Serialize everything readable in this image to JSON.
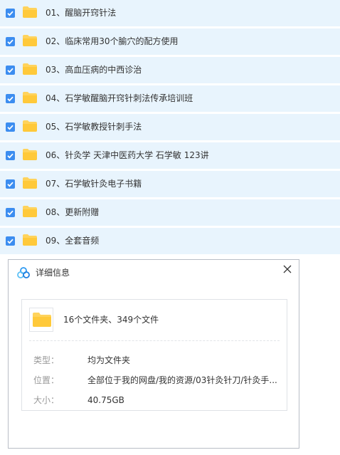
{
  "files": [
    {
      "name": "01、醒脑开窍针法"
    },
    {
      "name": "02、临床常用30个腧穴的配方使用"
    },
    {
      "name": "03、高血压病的中西诊治"
    },
    {
      "name": "04、石学敏醒脑开窍针刺法传承培训班"
    },
    {
      "name": "05、石学敏教授针刺手法"
    },
    {
      "name": "06、针灸学 天津中医药大学 石学敏 123讲"
    },
    {
      "name": "07、石学敏针灸电子书籍"
    },
    {
      "name": "08、更新附赠"
    },
    {
      "name": "09、全套音频"
    }
  ],
  "dialog": {
    "title": "详细信息",
    "summary": "16个文件夹、349个文件",
    "type_label": "类型：",
    "type_value": "均为文件夹",
    "location_label": "位置：",
    "location_value": "全部位于我的网盘/我的资源/03针灸针刀/针灸手...",
    "size_label": "大小：",
    "size_value": "40.75GB"
  },
  "colors": {
    "row_bg": "#e8f4fd",
    "checkbox": "#3c8df0",
    "folder": "#ffd35c"
  }
}
